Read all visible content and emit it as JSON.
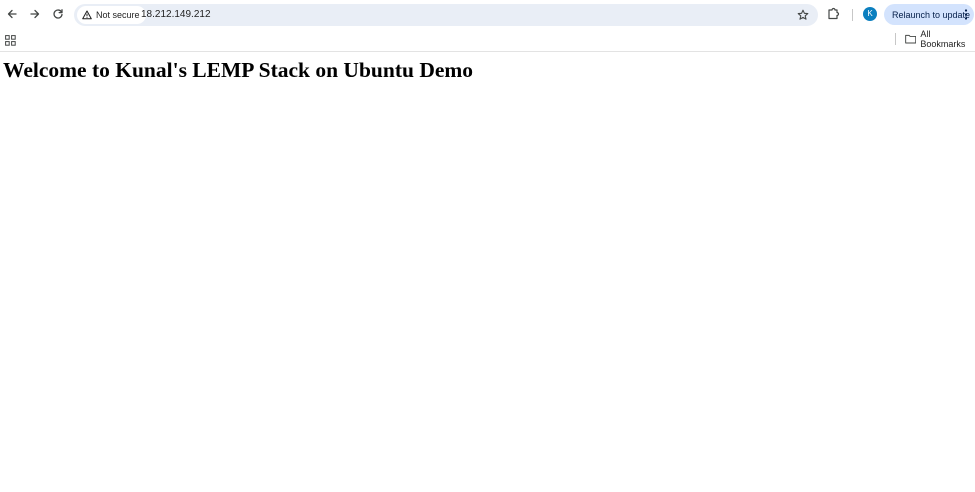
{
  "toolbar": {
    "back_icon": "arrow-left-icon",
    "forward_icon": "arrow-right-icon",
    "reload_icon": "reload-icon",
    "security_label": "Not secure",
    "security_icon": "warning-triangle-icon",
    "url": "18.212.149.212",
    "bookmark_icon": "star-icon",
    "extensions_icon": "puzzle-icon",
    "avatar_letter": "K",
    "relaunch_label": "Relaunch to update",
    "menu_icon": "three-dots-vertical-icon"
  },
  "bookmarks_bar": {
    "apps_icon": "apps-grid-icon",
    "all_bookmarks_label": "All Bookmarks",
    "folder_icon": "folder-icon"
  },
  "page": {
    "heading": "Welcome to Kunal's LEMP Stack on Ubuntu Demo"
  },
  "colors": {
    "omnibox_bg": "#e9eef6",
    "relaunch_bg": "#d3e3fd",
    "avatar_bg": "#0b7fbf",
    "page_bg": "#ffffff"
  }
}
